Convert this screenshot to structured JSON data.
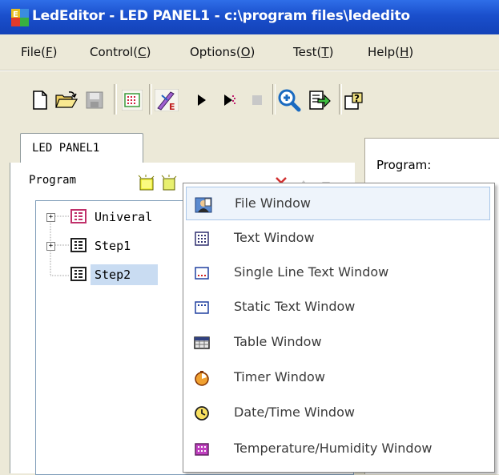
{
  "window": {
    "title": "LedEditor - LED PANEL1 - c:\\program files\\lededito",
    "icon": "app-icon"
  },
  "menubar": {
    "items": [
      {
        "label": "File(F)",
        "mnemonic": "F"
      },
      {
        "label": "Control(C)",
        "mnemonic": "C"
      },
      {
        "label": "Options(O)",
        "mnemonic": "O"
      },
      {
        "label": "Test(T)",
        "mnemonic": "T"
      },
      {
        "label": "Help(H)",
        "mnemonic": "H"
      }
    ]
  },
  "toolbar": {
    "buttons": [
      "new-file-icon",
      "open-folder-icon",
      "save-icon",
      "screen-icon",
      "edit-icon",
      "play-icon",
      "step-icon",
      "stop-icon",
      "zoom-icon",
      "export-icon",
      "help-icon"
    ]
  },
  "tabs": [
    {
      "label": "LED PANEL1",
      "active": true
    }
  ],
  "left_panel": {
    "program_label": "Program"
  },
  "tree": {
    "items": [
      {
        "label": "Univeral",
        "expandable": true,
        "selected": false,
        "icon_color": "#c0306a"
      },
      {
        "label": "Step1",
        "expandable": true,
        "selected": false,
        "icon_color": "#202020"
      },
      {
        "label": "Step2",
        "expandable": false,
        "selected": true,
        "icon_color": "#202020"
      }
    ]
  },
  "right_panel": {
    "program_label": "Program:"
  },
  "context_menu": {
    "items": [
      {
        "label": "File Window",
        "icon": "file-window-icon",
        "highlighted": true
      },
      {
        "label": "Text Window",
        "icon": "text-window-icon",
        "highlighted": false
      },
      {
        "label": "Single Line Text Window",
        "icon": "single-line-text-icon",
        "highlighted": false
      },
      {
        "label": "Static Text Window",
        "icon": "static-text-icon",
        "highlighted": false
      },
      {
        "label": "Table Window",
        "icon": "table-window-icon",
        "highlighted": false
      },
      {
        "label": "Timer Window",
        "icon": "timer-window-icon",
        "highlighted": false
      },
      {
        "label": "Date/Time Window",
        "icon": "clock-icon",
        "highlighted": false
      },
      {
        "label": "Temperature/Humidity Window",
        "icon": "temperature-humidity-icon",
        "highlighted": false
      }
    ]
  },
  "colors": {
    "titlebar": "#1a4fcc",
    "selection": "#c9dcf2",
    "menu_highlight": "#eef4fb"
  }
}
